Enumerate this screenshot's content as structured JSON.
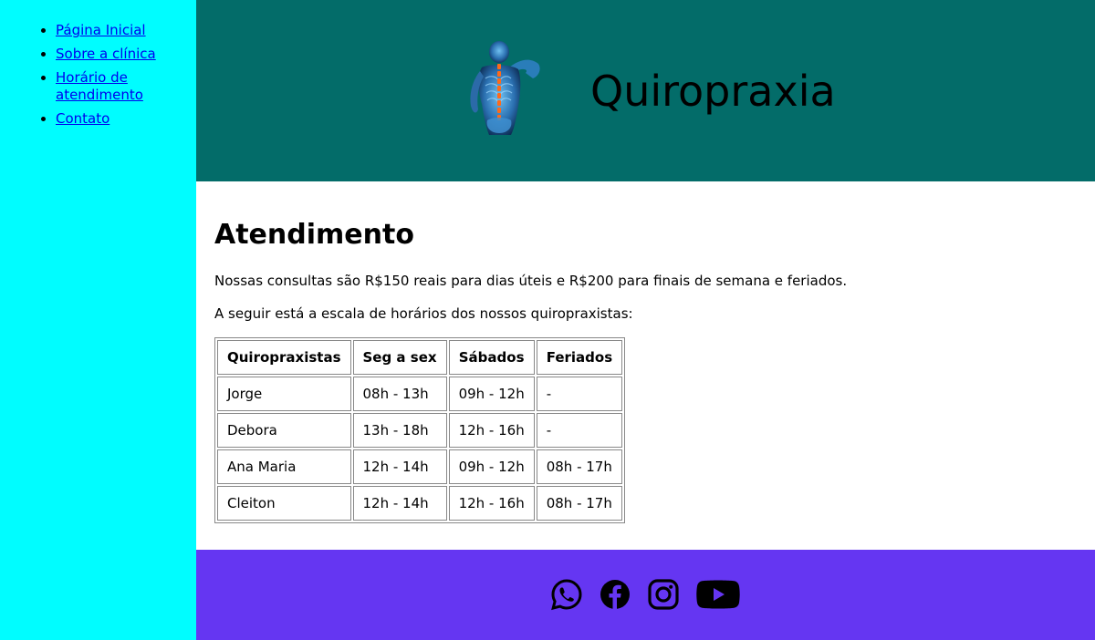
{
  "nav": {
    "items": [
      {
        "label": "Página Inicial"
      },
      {
        "label": "Sobre a clínica"
      },
      {
        "label": "Horário de atendimento"
      },
      {
        "label": "Contato"
      }
    ]
  },
  "header": {
    "logo_icon": "spine-skeleton-icon",
    "title": "Quiropraxia"
  },
  "main": {
    "heading": "Atendimento",
    "paragraph_1": "Nossas consultas são R$150 reais para dias úteis e R$200 para finais de semana e feriados.",
    "paragraph_2": "A seguir está a escala de horários dos nossos quiropraxistas:",
    "table": {
      "headers": [
        "Quiropraxistas",
        "Seg a sex",
        "Sábados",
        "Feriados"
      ],
      "rows": [
        [
          "Jorge",
          "08h - 13h",
          "09h - 12h",
          "-"
        ],
        [
          "Debora",
          "13h - 18h",
          "12h - 16h",
          "-"
        ],
        [
          "Ana Maria",
          "12h - 14h",
          "09h - 12h",
          "08h - 17h"
        ],
        [
          "Cleiton",
          "12h - 14h",
          "12h - 16h",
          "08h - 17h"
        ]
      ]
    }
  },
  "footer": {
    "social_icons": [
      "whatsapp-icon",
      "facebook-icon",
      "instagram-icon",
      "youtube-icon"
    ]
  },
  "colors": {
    "sidebar_bg": "#00fdff",
    "header_bg": "#036c69",
    "footer_bg": "#6536f2",
    "link": "#0000ee"
  }
}
